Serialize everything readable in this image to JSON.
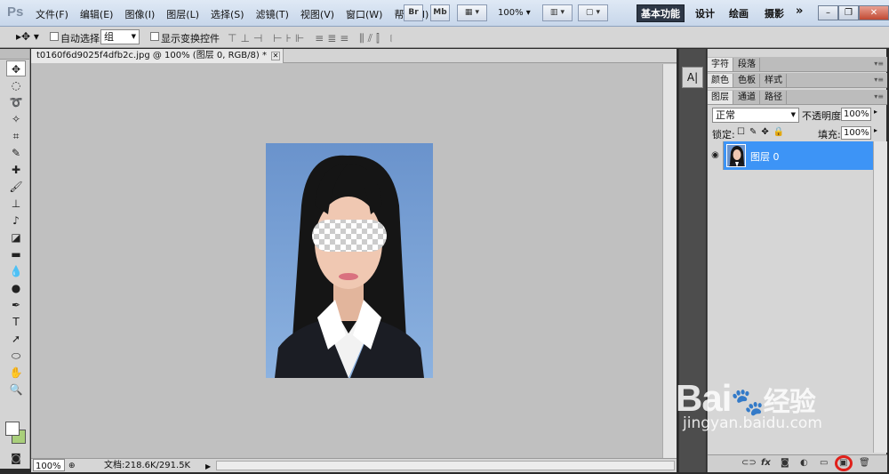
{
  "menubar": {
    "logo": "Ps",
    "items": [
      "文件(F)",
      "编辑(E)",
      "图像(I)",
      "图层(L)",
      "选择(S)",
      "滤镜(T)",
      "视图(V)",
      "窗口(W)",
      "帮助(H)"
    ],
    "bridge_btn": "Br",
    "minibridge_btn": "Mb",
    "zoom": "100%",
    "workspaces": [
      "基本功能",
      "设计",
      "绘画",
      "摄影"
    ],
    "more": "»"
  },
  "options": {
    "auto_select_label": "自动选择:",
    "auto_select_value": "组",
    "transform_label": "显示变换控件"
  },
  "document": {
    "tab_title": "t0160f6d9025f4dfb2c.jpg @ 100% (图层 0, RGB/8) *",
    "zoom": "100%",
    "file_info": "文档:218.6K/291.5K"
  },
  "panels": {
    "tabs_row1": [
      "字符",
      "段落"
    ],
    "tabs_row2": [
      "颜色",
      "色板",
      "样式"
    ],
    "tabs_row3": [
      "图层",
      "通道",
      "路径"
    ],
    "blend_mode": "正常",
    "opacity_label": "不透明度:",
    "opacity_value": "100%",
    "lock_label": "锁定:",
    "fill_label": "填充:",
    "fill_value": "100%",
    "layer_name": "图层 0"
  },
  "watermark": {
    "brand": "Bai",
    "brand_suffix": "经验",
    "url": "jingyan.baidu.com"
  },
  "colors": {
    "accent": "#3d94f6",
    "foreground": "#ffffff",
    "background": "#a9cf7b",
    "highlight": "#e0201a"
  }
}
